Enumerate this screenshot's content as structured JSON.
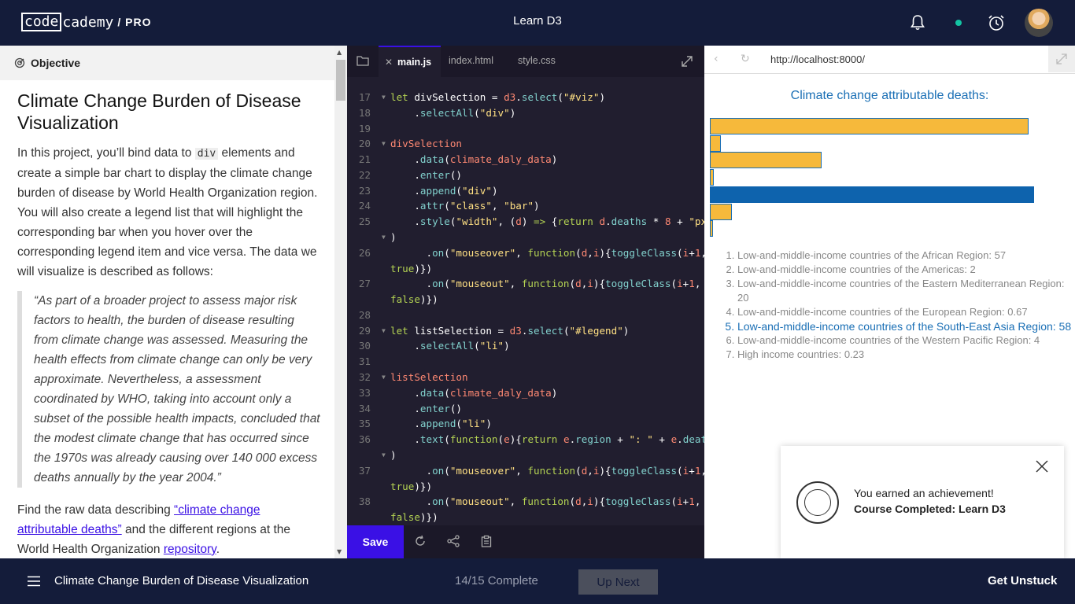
{
  "topbar": {
    "logo_box": "code",
    "logo_rest": "cademy",
    "logo_pro": "/ PRO",
    "course_title": "Learn D3"
  },
  "left": {
    "header": "Objective",
    "title": "Climate Change Burden of Disease Visualization",
    "intro_1": "In this project, you’ll bind data to ",
    "intro_code": "div",
    "intro_2": " elements and create a simple bar chart to display the climate change burden of disease by World Health Organization region. You will also create a legend list that will highlight the corresponding bar when you hover over the corresponding legend item and vice versa. The data we will visualize is described as follows:",
    "quote": "“As part of a broader project to assess major risk factors to health, the burden of disease resulting from climate change was assessed. Measuring the health effects from climate change can only be very approximate. Nevertheless, a assessment coordinated by WHO, taking into account only a subset of the possible health impacts, concluded that the modest climate change that has occurred since the 1970s was already causing over 140 000 excess deaths annually by the year 2004.”",
    "find_1": "Find the raw data describing ",
    "find_link": "“climate change attributable deaths”",
    "find_2": " and the different regions at the World Health Organization ",
    "find_link2": "repository",
    "find_3": "."
  },
  "editor": {
    "tabs": [
      "main.js",
      "index.html",
      "style.css"
    ],
    "save_label": "Save"
  },
  "browser": {
    "url": "http://localhost:8000/",
    "viz_title": "Climate change attributable deaths:"
  },
  "chart_data": {
    "type": "bar",
    "title": "Climate change attributable deaths:",
    "orientation": "horizontal",
    "categories": [
      "Low-and-middle-income countries of the African Region",
      "Low-and-middle-income countries of the Americas",
      "Low-and-middle-income countries of the Eastern Mediterranean Region",
      "Low-and-middle-income countries of the European Region",
      "Low-and-middle-income countries of the South-East Asia Region",
      "Low-and-middle-income countries of the Western Pacific Region",
      "High income countries"
    ],
    "values": [
      57,
      2,
      20,
      0.67,
      58,
      4,
      0.23
    ],
    "highlighted_index": 4,
    "colors": {
      "bar": "#f6b93b",
      "highlight": "#0e63ad",
      "border": "#1a6fb5"
    }
  },
  "legend": [
    "Low-and-middle-income countries of the African Region: 57",
    "Low-and-middle-income countries of the Americas: 2",
    "Low-and-middle-income countries of the Eastern Mediterranean Region: 20",
    "Low-and-middle-income countries of the European Region: 0.67",
    "Low-and-middle-income countries of the South-East Asia Region: 58",
    "Low-and-middle-income countries of the Western Pacific Region: 4",
    "High income countries: 0.23"
  ],
  "toast": {
    "line1": "You earned an achievement!",
    "line2": "Course Completed: Learn D3"
  },
  "footer": {
    "lesson_title": "Climate Change Burden of Disease Visualization",
    "progress": "14/15 Complete",
    "up_next": "Up Next",
    "get_unstuck": "Get Unstuck"
  },
  "colors": {
    "navy": "#141c3a",
    "accent": "#3a10e5",
    "editor_bg": "#211e2f"
  }
}
